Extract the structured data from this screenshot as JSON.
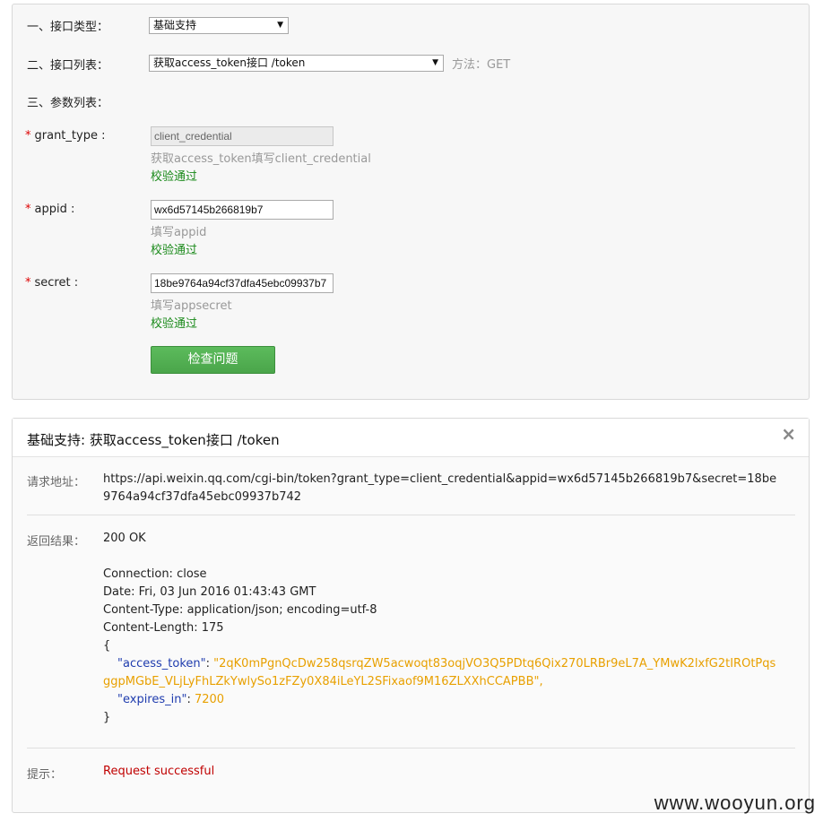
{
  "form": {
    "row1_label": "一、接口类型：",
    "type_select": "基础支持",
    "row2_label": "二、接口列表：",
    "api_select": "获取access_token接口 /token",
    "method": "方法：GET",
    "row3_label": "三、参数列表：",
    "params": [
      {
        "name": "grant_type :",
        "value": "client_credential",
        "hint": "获取access_token填写client_credential",
        "status": "校验通过"
      },
      {
        "name": "appid :",
        "value": "wx6d57145b266819b7",
        "hint": "填写appid",
        "status": "校验通过"
      },
      {
        "name": "secret :",
        "value": "18be9764a94cf37dfa45ebc09937b7",
        "hint": "填写appsecret",
        "status": "校验通过"
      }
    ],
    "check_button": "检查问题"
  },
  "result": {
    "title": "基础支持: 获取access_token接口 /token",
    "close": "×",
    "url_label": "请求地址：",
    "url_line1": "https://api.weixin.qq.com/cgi-bin/token?grant_type=client_credential&appid=wx6d57145b266819b7&secret=18be",
    "url_line2": "9764a94cf37dfa45ebc09937b742",
    "result_label": "返回结果：",
    "status": "200 OK",
    "headers": [
      "Connection: close",
      "Date: Fri, 03 Jun 2016 01:43:43 GMT",
      "Content-Type: application/json; encoding=utf-8",
      "Content-Length: 175"
    ],
    "json_open": "{",
    "token_key": "\"access_token\"",
    "token_val1": "\"2qK0mPgnQcDw258qsrqZW5acwoqt83oqjVO3Q5PDtq6Qix270LRBr9eL7A_YMwK2lxfG2tIROtPqs",
    "token_val2": "ggpMGbE_VLjLyFhLZkYwlySo1zFZy0X84iLeYL2SFixaof9M16ZLXXhCCAPBB\",",
    "expires_key": "\"expires_in\"",
    "expires_val": "7200",
    "json_close": "}",
    "tip_label": "提示：",
    "tip_value": "Request successful"
  },
  "watermark": "www.wooyun.org"
}
